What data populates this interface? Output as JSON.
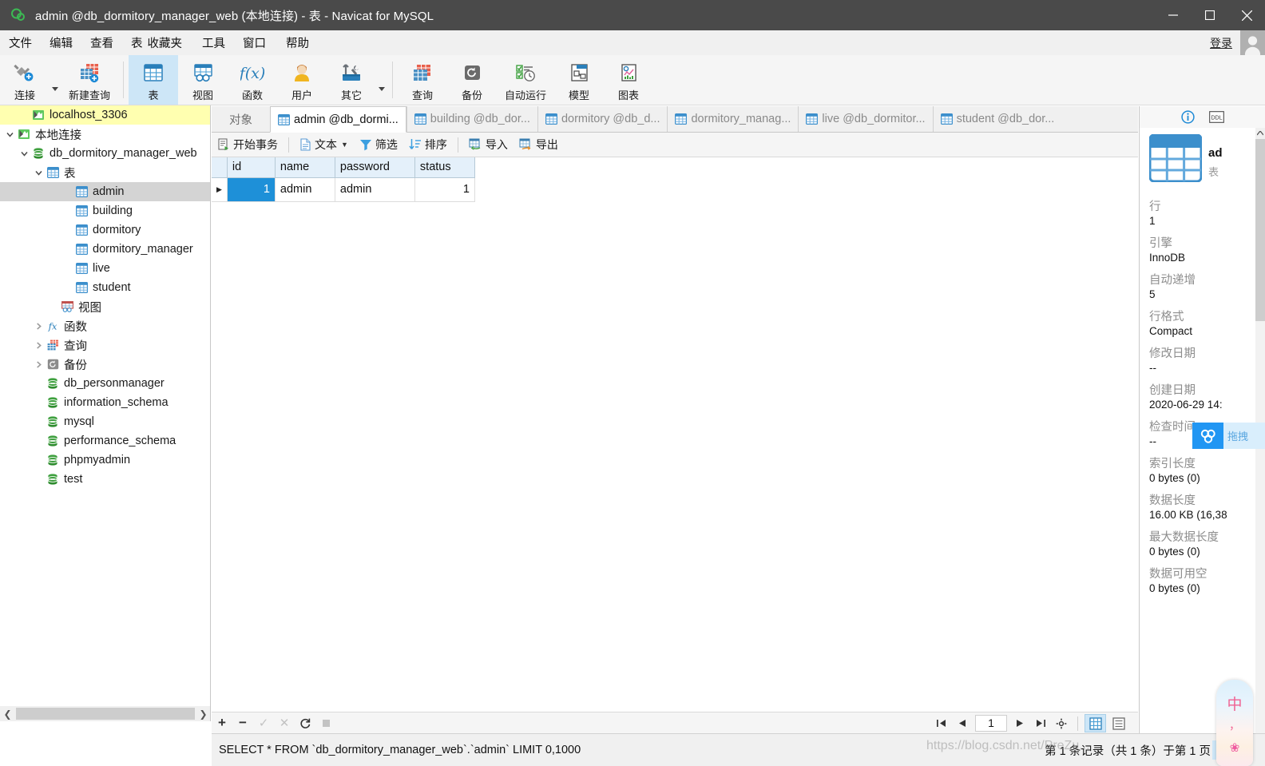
{
  "window": {
    "title": "admin @db_dormitory_manager_web (本地连接) - 表 - Navicat for MySQL",
    "logo_icon": "navicat-logo-icon",
    "minimize_icon": "minimize-icon",
    "maximize_icon": "maximize-icon",
    "close_icon": "close-icon"
  },
  "menubar": {
    "items": [
      {
        "label": "文件",
        "name": "menu-file"
      },
      {
        "label": "编辑",
        "name": "menu-edit"
      },
      {
        "label": "查看",
        "name": "menu-view"
      },
      {
        "label": "表",
        "name": "menu-table"
      },
      {
        "label": "收藏夹",
        "name": "menu-favorites"
      },
      {
        "label": "工具",
        "name": "menu-tools"
      },
      {
        "label": "窗口",
        "name": "menu-window"
      },
      {
        "label": "帮助",
        "name": "menu-help"
      }
    ],
    "login_label": "登录"
  },
  "toolbar": {
    "buttons": [
      {
        "label": "连接",
        "icon": "connection-icon",
        "has_caret": true,
        "active": false
      },
      {
        "label": "新建查询",
        "icon": "new-query-icon",
        "has_caret": false,
        "active": false
      },
      {
        "label": "表",
        "icon": "table-icon",
        "has_caret": false,
        "active": true
      },
      {
        "label": "视图",
        "icon": "view-icon",
        "has_caret": false,
        "active": false
      },
      {
        "label": "函数",
        "icon": "function-icon",
        "has_caret": false,
        "active": false
      },
      {
        "label": "用户",
        "icon": "user-icon",
        "has_caret": false,
        "active": false
      },
      {
        "label": "其它",
        "icon": "others-icon",
        "has_caret": true,
        "active": false
      },
      {
        "label": "查询",
        "icon": "query-icon",
        "has_caret": false,
        "active": false
      },
      {
        "label": "备份",
        "icon": "backup-icon",
        "has_caret": false,
        "active": false
      },
      {
        "label": "自动运行",
        "icon": "automation-icon",
        "has_caret": false,
        "active": false
      },
      {
        "label": "模型",
        "icon": "model-icon",
        "has_caret": false,
        "active": false
      },
      {
        "label": "图表",
        "icon": "chart-icon",
        "has_caret": false,
        "active": false
      }
    ]
  },
  "sidebar": {
    "nodes": [
      {
        "label": "localhost_3306",
        "indent": 1,
        "icon": "connection-node-icon",
        "arrow": "none",
        "state": "root"
      },
      {
        "label": "本地连接",
        "indent": 0,
        "icon": "connection-node-icon",
        "arrow": "down",
        "state": "normal"
      },
      {
        "label": "db_dormitory_manager_web",
        "indent": 1,
        "icon": "database-icon",
        "arrow": "down",
        "state": "normal"
      },
      {
        "label": "表",
        "indent": 2,
        "icon": "tables-folder-icon",
        "arrow": "down",
        "state": "normal"
      },
      {
        "label": "admin",
        "indent": 4,
        "icon": "table-node-icon",
        "arrow": "none",
        "state": "selected"
      },
      {
        "label": "building",
        "indent": 4,
        "icon": "table-node-icon",
        "arrow": "none",
        "state": "normal"
      },
      {
        "label": "dormitory",
        "indent": 4,
        "icon": "table-node-icon",
        "arrow": "none",
        "state": "normal"
      },
      {
        "label": "dormitory_manager",
        "indent": 4,
        "icon": "table-node-icon",
        "arrow": "none",
        "state": "normal"
      },
      {
        "label": "live",
        "indent": 4,
        "icon": "table-node-icon",
        "arrow": "none",
        "state": "normal"
      },
      {
        "label": "student",
        "indent": 4,
        "icon": "table-node-icon",
        "arrow": "none",
        "state": "normal"
      },
      {
        "label": "视图",
        "indent": 3,
        "icon": "views-folder-icon",
        "arrow": "none",
        "state": "normal"
      },
      {
        "label": "函数",
        "indent": 2,
        "icon": "functions-folder-icon",
        "arrow": "right",
        "state": "normal"
      },
      {
        "label": "查询",
        "indent": 2,
        "icon": "queries-folder-icon",
        "arrow": "right",
        "state": "normal"
      },
      {
        "label": "备份",
        "indent": 2,
        "icon": "backups-folder-icon",
        "arrow": "right",
        "state": "normal"
      },
      {
        "label": "db_personmanager",
        "indent": 2,
        "icon": "database-icon",
        "arrow": "none",
        "state": "normal"
      },
      {
        "label": "information_schema",
        "indent": 2,
        "icon": "database-icon",
        "arrow": "none",
        "state": "normal"
      },
      {
        "label": "mysql",
        "indent": 2,
        "icon": "database-icon",
        "arrow": "none",
        "state": "normal"
      },
      {
        "label": "performance_schema",
        "indent": 2,
        "icon": "database-icon",
        "arrow": "none",
        "state": "normal"
      },
      {
        "label": "phpmyadmin",
        "indent": 2,
        "icon": "database-icon",
        "arrow": "none",
        "state": "normal"
      },
      {
        "label": "test",
        "indent": 2,
        "icon": "database-icon",
        "arrow": "none",
        "state": "normal"
      }
    ]
  },
  "tabs": [
    {
      "label": "对象",
      "icon": null,
      "active": false,
      "kind": "objects"
    },
    {
      "label": "admin @db_dormi...",
      "icon": "table-tab-icon",
      "active": true,
      "kind": "table"
    },
    {
      "label": "building @db_dor...",
      "icon": "table-tab-icon",
      "active": false,
      "kind": "table"
    },
    {
      "label": "dormitory @db_d...",
      "icon": "table-tab-icon",
      "active": false,
      "kind": "table"
    },
    {
      "label": "dormitory_manag...",
      "icon": "table-tab-icon",
      "active": false,
      "kind": "table"
    },
    {
      "label": "live @db_dormitor...",
      "icon": "table-tab-icon",
      "active": false,
      "kind": "table"
    },
    {
      "label": "student @db_dor...",
      "icon": "table-tab-icon",
      "active": false,
      "kind": "table"
    }
  ],
  "gridbar": {
    "buttons": [
      {
        "label": "开始事务",
        "icon": "begin-transaction-icon",
        "caret": false
      },
      {
        "label": "文本",
        "icon": "text-icon",
        "caret": true
      },
      {
        "label": "筛选",
        "icon": "filter-icon",
        "caret": false
      },
      {
        "label": "排序",
        "icon": "sort-icon",
        "caret": false
      },
      {
        "label": "导入",
        "icon": "import-icon",
        "caret": false
      },
      {
        "label": "导出",
        "icon": "export-icon",
        "caret": false
      }
    ]
  },
  "grid": {
    "columns": [
      "id",
      "name",
      "password",
      "status"
    ],
    "rows": [
      {
        "id": "1",
        "name": "admin",
        "password": "admin",
        "status": "1",
        "selected_cell": "id",
        "marker": "▶"
      }
    ]
  },
  "gridnav": {
    "edit_icons": [
      {
        "name": "add-record-button",
        "glyph": "+",
        "dim": false
      },
      {
        "name": "delete-record-button",
        "glyph": "−",
        "dim": false
      },
      {
        "name": "apply-change-button",
        "glyph": "✓",
        "dim": true
      },
      {
        "name": "cancel-change-button",
        "glyph": "✕",
        "dim": true
      },
      {
        "name": "refresh-button",
        "glyph": "⟳",
        "dim": false
      },
      {
        "name": "stop-button",
        "glyph": "■",
        "dim": true
      }
    ],
    "page_value": "1",
    "nav_icons": [
      {
        "name": "first-page-button",
        "glyph": "|◀"
      },
      {
        "name": "prev-page-button",
        "glyph": "◀"
      },
      {
        "name": "next-page-button",
        "glyph": "▶"
      },
      {
        "name": "last-page-button",
        "glyph": "▶|"
      },
      {
        "name": "page-settings-button",
        "glyph": "⚙"
      }
    ],
    "view_grid_label": "grid-view-toggle",
    "view_form_label": "form-view-toggle"
  },
  "statusbar": {
    "sql": "SELECT * FROM `db_dormitory_manager_web`.`admin` LIMIT 0,1000",
    "record_info": "第 1 条记录（共 1 条）于第 1 页"
  },
  "infopanel": {
    "info_icon": "info-icon",
    "ddl_icon": "ddl-icon",
    "object_icon": "table-big-icon",
    "object_name": "ad",
    "object_type": "表",
    "fields": [
      {
        "label": "行",
        "value": "1"
      },
      {
        "label": "引擎",
        "value": "InnoDB"
      },
      {
        "label": "自动递增",
        "value": "5"
      },
      {
        "label": "行格式",
        "value": "Compact"
      },
      {
        "label": "修改日期",
        "value": "--"
      },
      {
        "label": "创建日期",
        "value": "2020-06-29 14:"
      },
      {
        "label": "检查时间",
        "value": "--"
      },
      {
        "label": "索引长度",
        "value": "0 bytes (0)"
      },
      {
        "label": "数据长度",
        "value": "16.00 KB (16,38"
      },
      {
        "label": "最大数据长度",
        "value": "0 bytes (0)"
      },
      {
        "label": "数据可用空",
        "value": "0 bytes (0)"
      }
    ]
  },
  "overlays": {
    "netdisk_label": "拖拽",
    "netdisk_icon": "baidu-netdisk-icon",
    "ime_char": "中",
    "ime_punct": "，",
    "ime_flower": "❀",
    "watermark": "https://blog.csdn.net/PreZu..."
  },
  "colors": {
    "titlebar": "#4a4a4a",
    "accent_blue": "#1e90d8",
    "root_highlight": "#ffffb0",
    "selected_node": "#d4d4d4",
    "toolbar_active": "#cde6f7",
    "header_blue": "#e4f0fa"
  }
}
